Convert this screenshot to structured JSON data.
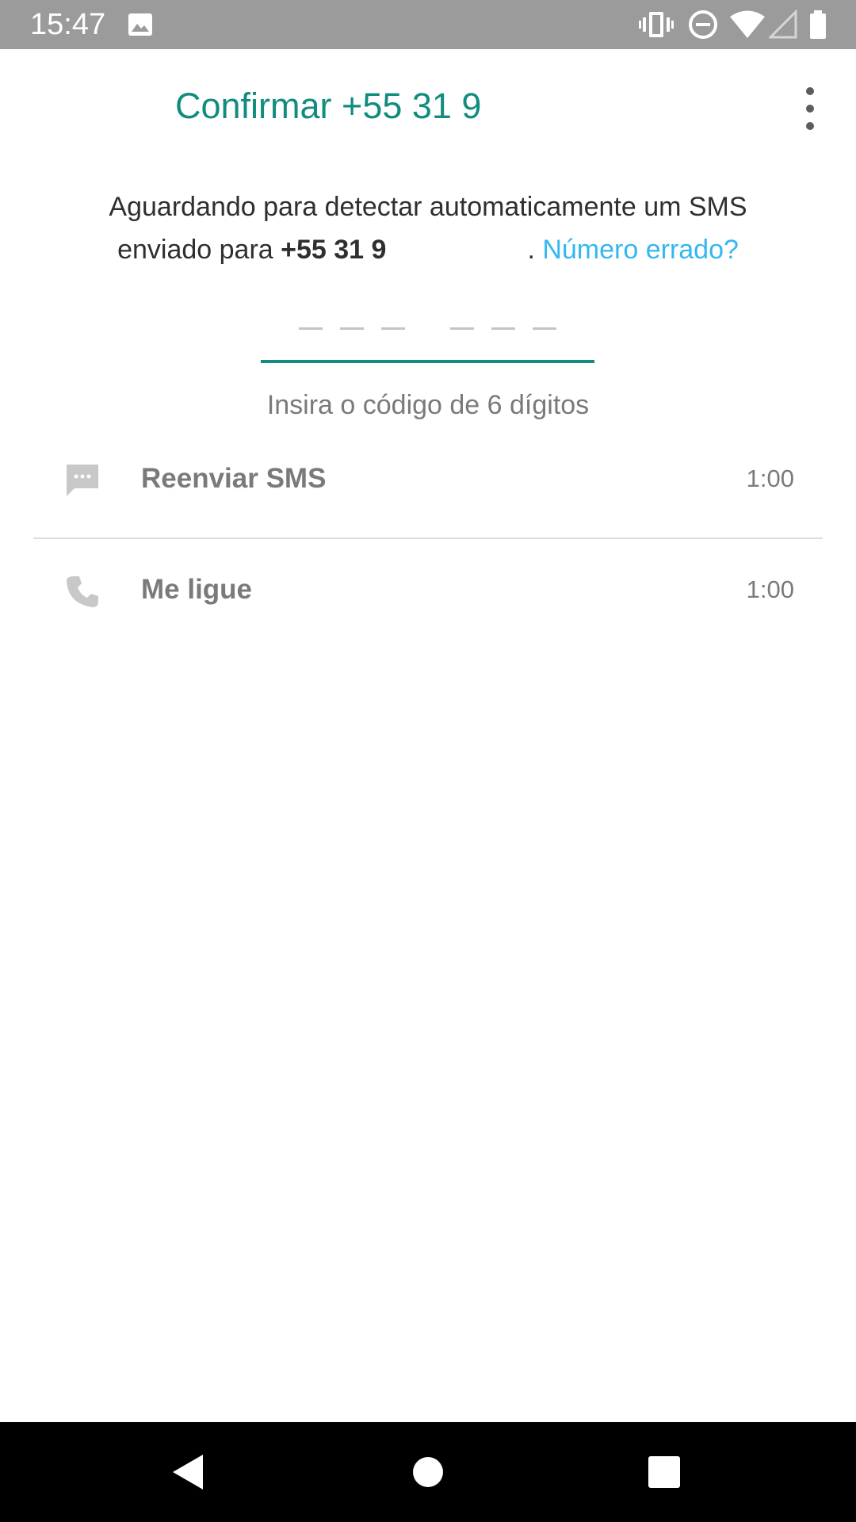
{
  "status_bar": {
    "time": "15:47",
    "icons": [
      "image-icon",
      "vibrate-icon",
      "do-not-disturb-icon",
      "wifi-icon",
      "cellular-signal-icon",
      "battery-icon"
    ]
  },
  "app_bar": {
    "title": "Confirmar +55 31 9",
    "menu_icon": "more-vert-icon"
  },
  "description": {
    "line1": "Aguardando para detectar automaticamente um SMS",
    "line2_prefix": "enviado para ",
    "phone": "+55 31 9",
    "separator": ".",
    "wrong_number_link": "Número errado?"
  },
  "code_input": {
    "digits": 6,
    "hint": "Insira o código de 6 dígitos"
  },
  "actions": [
    {
      "label": "Reenviar SMS",
      "timer": "1:00",
      "icon": "sms-icon"
    },
    {
      "label": "Me ligue",
      "timer": "1:00",
      "icon": "phone-icon"
    }
  ],
  "nav_bar": {
    "buttons": [
      "back-icon",
      "home-icon",
      "recents-icon"
    ]
  },
  "colors": {
    "accent": "#128c7e",
    "link": "#34b7f1",
    "status_bar": "#9b9b9b",
    "muted_text": "#7a7a7a"
  }
}
